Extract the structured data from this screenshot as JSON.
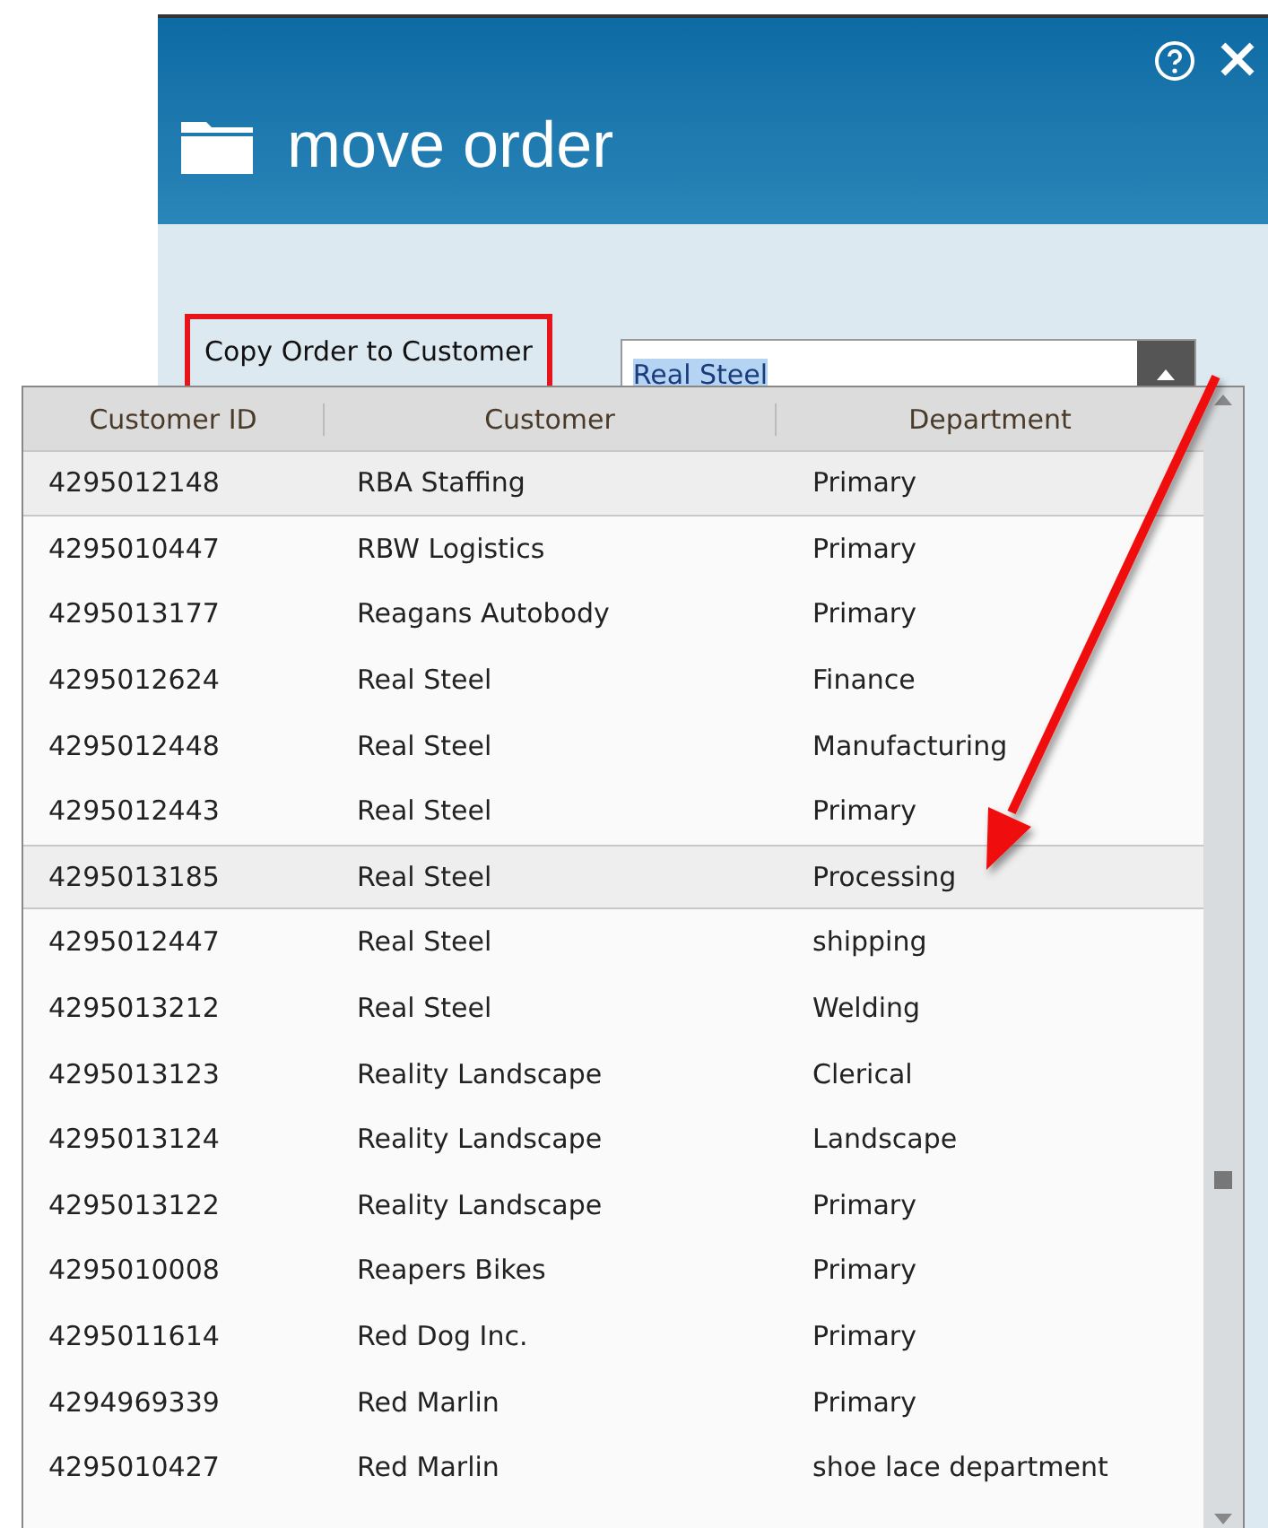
{
  "dialog": {
    "title": "move order",
    "field": {
      "label": "Copy Order to Customer",
      "value": "Real Steel",
      "expanded": true
    }
  },
  "dropdown": {
    "columns": [
      "Customer ID",
      "Customer",
      "Department"
    ],
    "rows": [
      {
        "id": "4295012148",
        "customer": "RBA Staffing",
        "department": "Primary",
        "highlighted": true
      },
      {
        "id": "4295010447",
        "customer": "RBW Logistics",
        "department": "Primary",
        "highlighted": false
      },
      {
        "id": "4295013177",
        "customer": "Reagans Autobody",
        "department": "Primary",
        "highlighted": false
      },
      {
        "id": "4295012624",
        "customer": "Real Steel",
        "department": "Finance",
        "highlighted": false
      },
      {
        "id": "4295012448",
        "customer": "Real Steel",
        "department": "Manufacturing",
        "highlighted": false
      },
      {
        "id": "4295012443",
        "customer": "Real Steel",
        "department": "Primary",
        "highlighted": false
      },
      {
        "id": "4295013185",
        "customer": "Real Steel",
        "department": "Processing",
        "highlighted": true
      },
      {
        "id": "4295012447",
        "customer": "Real Steel",
        "department": "shipping",
        "highlighted": false
      },
      {
        "id": "4295013212",
        "customer": "Real Steel",
        "department": "Welding",
        "highlighted": false
      },
      {
        "id": "4295013123",
        "customer": "Reality Landscape",
        "department": "Clerical",
        "highlighted": false
      },
      {
        "id": "4295013124",
        "customer": "Reality Landscape",
        "department": "Landscape",
        "highlighted": false
      },
      {
        "id": "4295013122",
        "customer": "Reality Landscape",
        "department": "Primary",
        "highlighted": false
      },
      {
        "id": "4295010008",
        "customer": "Reapers Bikes",
        "department": "Primary",
        "highlighted": false
      },
      {
        "id": "4295011614",
        "customer": "Red Dog Inc.",
        "department": "Primary",
        "highlighted": false
      },
      {
        "id": "4294969339",
        "customer": "Red Marlin",
        "department": "Primary",
        "highlighted": false
      },
      {
        "id": "4295010427",
        "customer": "Red Marlin",
        "department": "shoe lace department",
        "highlighted": false
      }
    ]
  }
}
